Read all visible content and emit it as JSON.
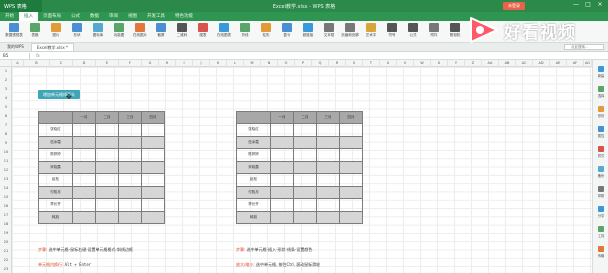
{
  "window": {
    "app_name": "WPS 表格",
    "title": "Excel教学.xlsx - WPS 表格",
    "login_label": "未登录",
    "minimize": "—",
    "maximize": "□",
    "close": "×"
  },
  "menu": [
    "开始",
    "插入",
    "页面布局",
    "公式",
    "数据",
    "审阅",
    "视图",
    "开发工具",
    "特色功能"
  ],
  "ribbon": [
    {
      "label": "数据透视表",
      "color": "#4a8fd1"
    },
    {
      "label": "表格",
      "color": "#5aa66a"
    },
    {
      "label": "图片",
      "color": "#e39b3a"
    },
    {
      "label": "形状",
      "color": "#4a8fd1"
    },
    {
      "label": "图标库",
      "color": "#57a9d0"
    },
    {
      "label": "功能图",
      "color": "#5aa66a"
    },
    {
      "label": "在线图片",
      "color": "#e3763a"
    },
    {
      "label": "截屏",
      "color": "#4a8fd1"
    },
    {
      "label": "二维码",
      "color": "#555"
    },
    {
      "label": "图表",
      "color": "#d9534f"
    },
    {
      "label": "在线图表",
      "color": "#3a9ad9"
    },
    {
      "label": "折线",
      "color": "#5aa66a"
    },
    {
      "label": "柱形",
      "color": "#e39b3a"
    },
    {
      "label": "盈亏",
      "color": "#4a8fd1"
    },
    {
      "label": "超链接",
      "color": "#3a9ad9"
    },
    {
      "label": "文本框",
      "color": "#777"
    },
    {
      "label": "页眉和页脚",
      "color": "#777"
    },
    {
      "label": "艺术字",
      "color": "#d9a43a"
    },
    {
      "label": "符号",
      "color": "#555"
    },
    {
      "label": "公式",
      "color": "#555"
    },
    {
      "label": "附件",
      "color": "#777"
    },
    {
      "label": "照相机",
      "color": "#555"
    },
    {
      "label": "对象",
      "color": "#4a8fd1"
    }
  ],
  "doc_tabs": [
    "我的WPS",
    "Excel教学.xlsx *"
  ],
  "search_placeholder": "点此搜索…",
  "name_box": "B5",
  "fx": "fx",
  "columns": [
    "A",
    "B",
    "C",
    "D",
    "E",
    "F",
    "G",
    "H",
    "I",
    "J",
    "K",
    "L",
    "M",
    "N",
    "O",
    "P",
    "Q",
    "R",
    "S",
    "T",
    "U",
    "V",
    "W",
    "X",
    "Y",
    "Z",
    "AA",
    "AB",
    "AC",
    "AD",
    "AE",
    "AF",
    "AG",
    "AH"
  ],
  "rows": [
    "1",
    "2",
    "3",
    "4",
    "5",
    "6",
    "7",
    "8",
    "9",
    "10",
    "11",
    "12",
    "13",
    "14",
    "15",
    "16",
    "17",
    "18",
    "19",
    "20",
    "21",
    "22",
    "23"
  ],
  "sheet_title": "增加单元格线表头",
  "left_table": {
    "headers": [
      "",
      "一月",
      "二月",
      "三月",
      "四月"
    ],
    "names": [
      "张晓红",
      "伍冰霜",
      "陈婷婷",
      "宋晓露",
      "赵松",
      "付知月",
      "李长齐",
      "韩旭"
    ]
  },
  "right_table": {
    "headers": [
      "",
      "一月",
      "二月",
      "三月",
      "四月"
    ],
    "names": [
      "张晓红",
      "伍冰霜",
      "陈婷婷",
      "宋晓露",
      "赵松",
      "付知月",
      "李长齐",
      "韩旭"
    ]
  },
  "notes": {
    "left1_key": "步骤:",
    "left1_text": "选中单元格-鼠标右键-设置单元格格式-斜线边框",
    "left2_key": "单元格内换行:",
    "left2_text": "Alt + Enter",
    "right1_key": "步骤:",
    "right1_text": "选中单元格-插入-形状-线条-设置颜色",
    "right2_key": "放大/缩小:",
    "right2_text": "选中单元格, 按住Ctrl, 滚动鼠标滑轮"
  },
  "sidebar": [
    "新建",
    "选择",
    "形状",
    "属性",
    "样式",
    "备份",
    "帮助",
    "分享",
    "工具",
    "传输"
  ],
  "watermark": "好看视频"
}
